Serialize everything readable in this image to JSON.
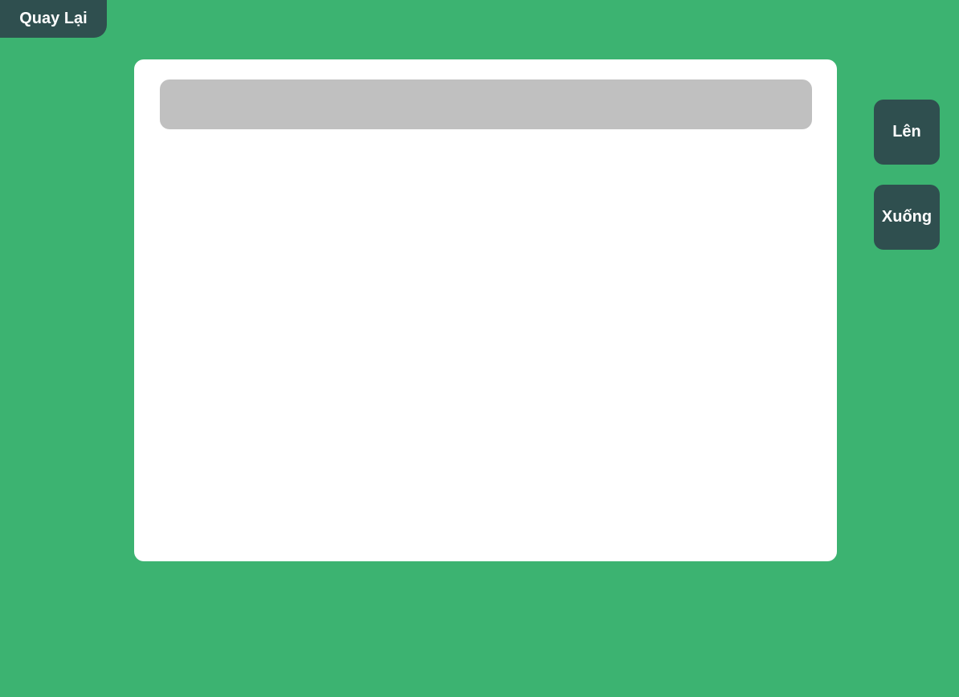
{
  "nav": {
    "back_label": "Quay Lại"
  },
  "scroll": {
    "up_label": "Lên",
    "down_label": "Xuống"
  },
  "colors": {
    "background": "#3cb371",
    "button": "#2f4f4f",
    "panel": "#ffffff",
    "bar": "#c0c0c0",
    "button_text": "#ffffff"
  }
}
